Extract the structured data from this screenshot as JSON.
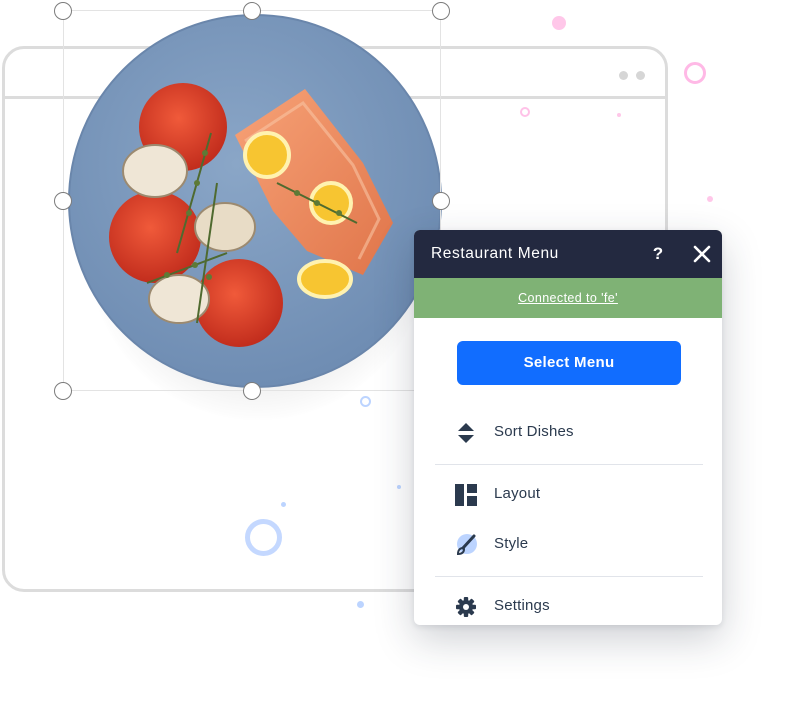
{
  "panel": {
    "title": "Restaurant Menu",
    "help_label": "?",
    "status_text": "Connected to 'fe'",
    "select_button_label": "Select Menu",
    "menu_items": [
      {
        "label": "Sort Dishes",
        "icon": "sort-arrows-icon"
      },
      {
        "label": "Layout",
        "icon": "layout-icon"
      },
      {
        "label": "Style",
        "icon": "brush-icon"
      },
      {
        "label": "Settings",
        "icon": "gear-icon"
      }
    ]
  },
  "colors": {
    "header_bg": "#232940",
    "status_bg": "#7fb275",
    "button_bg": "#116dff",
    "plate": "#7f9bbd"
  },
  "image": {
    "subject": "salmon-plate-photo"
  }
}
